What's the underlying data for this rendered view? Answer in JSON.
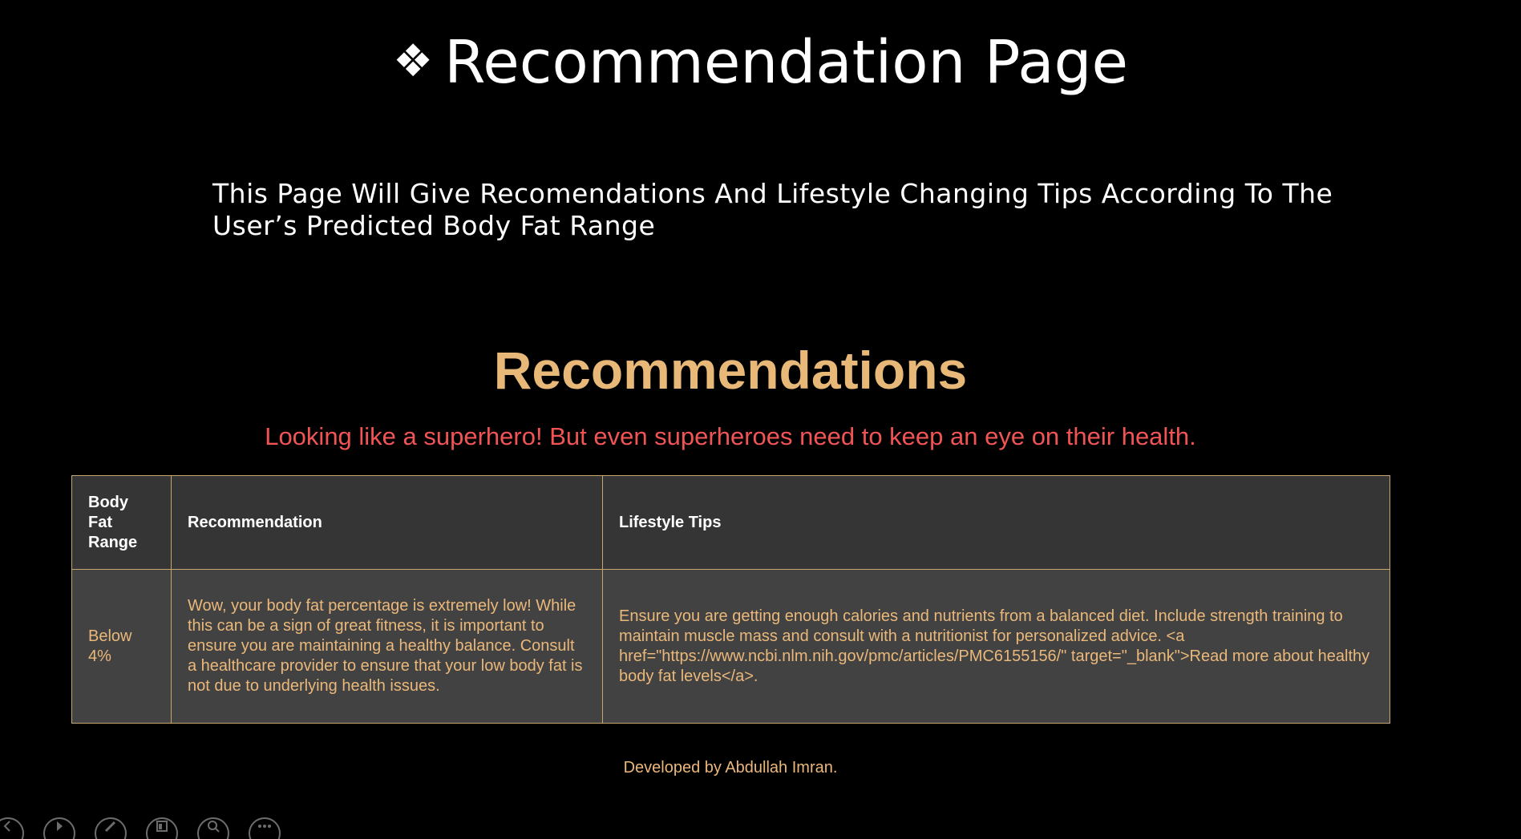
{
  "slide": {
    "title_bullet": "❖",
    "title": "Recommendation Page",
    "subtitle": "This Page Will Give Recomendations And Lifestyle Changing Tips According To The User’s Predicted Body Fat Range"
  },
  "recommendations": {
    "heading": "Recommendations",
    "message": "Looking like a superhero! But even superheroes need to keep an eye on their health.",
    "table": {
      "headers": [
        "Body Fat Range",
        "Recommendation",
        "Lifestyle Tips"
      ],
      "rows": [
        {
          "range": "Below 4%",
          "recommendation": "Wow, your body fat percentage is extremely low! While this can be a sign of great fitness, it is important to ensure you are maintaining a healthy balance. Consult a healthcare provider to ensure that your low body fat is not due to underlying health issues.",
          "tips": "Ensure you are getting enough calories and nutrients from a balanced diet. Include strength training to maintain muscle mass and consult with a nutritionist for personalized advice. <a href=\"https://www.ncbi.nlm.nih.gov/pmc/articles/PMC6155156/\" target=\"_blank\">Read more about healthy body fat levels</a>."
        }
      ]
    }
  },
  "footer": {
    "text": "Developed by Abdullah Imran."
  },
  "controls": {
    "icons": [
      "previous-icon",
      "next-icon",
      "pen-icon",
      "slides-grid-icon",
      "zoom-icon",
      "more-options-icon"
    ]
  },
  "colors": {
    "background": "#000000",
    "heading": "#e8b878",
    "message": "#f05454",
    "table_header_bg": "#353535",
    "table_cell_bg": "#424242",
    "table_border": "#c9a66b",
    "cell_text": "#eab87a"
  }
}
